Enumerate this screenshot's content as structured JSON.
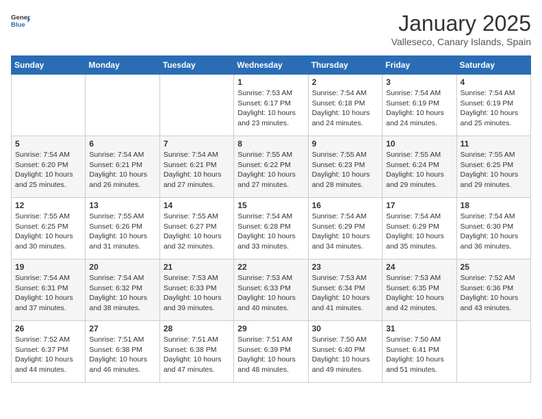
{
  "header": {
    "logo": {
      "general": "General",
      "blue": "Blue"
    },
    "title": "January 2025",
    "subtitle": "Valleseco, Canary Islands, Spain"
  },
  "days_of_week": [
    "Sunday",
    "Monday",
    "Tuesday",
    "Wednesday",
    "Thursday",
    "Friday",
    "Saturday"
  ],
  "weeks": [
    [
      {
        "day": "",
        "sunrise": "",
        "sunset": "",
        "daylight": ""
      },
      {
        "day": "",
        "sunrise": "",
        "sunset": "",
        "daylight": ""
      },
      {
        "day": "",
        "sunrise": "",
        "sunset": "",
        "daylight": ""
      },
      {
        "day": "1",
        "sunrise": "Sunrise: 7:53 AM",
        "sunset": "Sunset: 6:17 PM",
        "daylight": "Daylight: 10 hours and 23 minutes."
      },
      {
        "day": "2",
        "sunrise": "Sunrise: 7:54 AM",
        "sunset": "Sunset: 6:18 PM",
        "daylight": "Daylight: 10 hours and 24 minutes."
      },
      {
        "day": "3",
        "sunrise": "Sunrise: 7:54 AM",
        "sunset": "Sunset: 6:19 PM",
        "daylight": "Daylight: 10 hours and 24 minutes."
      },
      {
        "day": "4",
        "sunrise": "Sunrise: 7:54 AM",
        "sunset": "Sunset: 6:19 PM",
        "daylight": "Daylight: 10 hours and 25 minutes."
      }
    ],
    [
      {
        "day": "5",
        "sunrise": "Sunrise: 7:54 AM",
        "sunset": "Sunset: 6:20 PM",
        "daylight": "Daylight: 10 hours and 25 minutes."
      },
      {
        "day": "6",
        "sunrise": "Sunrise: 7:54 AM",
        "sunset": "Sunset: 6:21 PM",
        "daylight": "Daylight: 10 hours and 26 minutes."
      },
      {
        "day": "7",
        "sunrise": "Sunrise: 7:54 AM",
        "sunset": "Sunset: 6:21 PM",
        "daylight": "Daylight: 10 hours and 27 minutes."
      },
      {
        "day": "8",
        "sunrise": "Sunrise: 7:55 AM",
        "sunset": "Sunset: 6:22 PM",
        "daylight": "Daylight: 10 hours and 27 minutes."
      },
      {
        "day": "9",
        "sunrise": "Sunrise: 7:55 AM",
        "sunset": "Sunset: 6:23 PM",
        "daylight": "Daylight: 10 hours and 28 minutes."
      },
      {
        "day": "10",
        "sunrise": "Sunrise: 7:55 AM",
        "sunset": "Sunset: 6:24 PM",
        "daylight": "Daylight: 10 hours and 29 minutes."
      },
      {
        "day": "11",
        "sunrise": "Sunrise: 7:55 AM",
        "sunset": "Sunset: 6:25 PM",
        "daylight": "Daylight: 10 hours and 29 minutes."
      }
    ],
    [
      {
        "day": "12",
        "sunrise": "Sunrise: 7:55 AM",
        "sunset": "Sunset: 6:25 PM",
        "daylight": "Daylight: 10 hours and 30 minutes."
      },
      {
        "day": "13",
        "sunrise": "Sunrise: 7:55 AM",
        "sunset": "Sunset: 6:26 PM",
        "daylight": "Daylight: 10 hours and 31 minutes."
      },
      {
        "day": "14",
        "sunrise": "Sunrise: 7:55 AM",
        "sunset": "Sunset: 6:27 PM",
        "daylight": "Daylight: 10 hours and 32 minutes."
      },
      {
        "day": "15",
        "sunrise": "Sunrise: 7:54 AM",
        "sunset": "Sunset: 6:28 PM",
        "daylight": "Daylight: 10 hours and 33 minutes."
      },
      {
        "day": "16",
        "sunrise": "Sunrise: 7:54 AM",
        "sunset": "Sunset: 6:29 PM",
        "daylight": "Daylight: 10 hours and 34 minutes."
      },
      {
        "day": "17",
        "sunrise": "Sunrise: 7:54 AM",
        "sunset": "Sunset: 6:29 PM",
        "daylight": "Daylight: 10 hours and 35 minutes."
      },
      {
        "day": "18",
        "sunrise": "Sunrise: 7:54 AM",
        "sunset": "Sunset: 6:30 PM",
        "daylight": "Daylight: 10 hours and 36 minutes."
      }
    ],
    [
      {
        "day": "19",
        "sunrise": "Sunrise: 7:54 AM",
        "sunset": "Sunset: 6:31 PM",
        "daylight": "Daylight: 10 hours and 37 minutes."
      },
      {
        "day": "20",
        "sunrise": "Sunrise: 7:54 AM",
        "sunset": "Sunset: 6:32 PM",
        "daylight": "Daylight: 10 hours and 38 minutes."
      },
      {
        "day": "21",
        "sunrise": "Sunrise: 7:53 AM",
        "sunset": "Sunset: 6:33 PM",
        "daylight": "Daylight: 10 hours and 39 minutes."
      },
      {
        "day": "22",
        "sunrise": "Sunrise: 7:53 AM",
        "sunset": "Sunset: 6:33 PM",
        "daylight": "Daylight: 10 hours and 40 minutes."
      },
      {
        "day": "23",
        "sunrise": "Sunrise: 7:53 AM",
        "sunset": "Sunset: 6:34 PM",
        "daylight": "Daylight: 10 hours and 41 minutes."
      },
      {
        "day": "24",
        "sunrise": "Sunrise: 7:53 AM",
        "sunset": "Sunset: 6:35 PM",
        "daylight": "Daylight: 10 hours and 42 minutes."
      },
      {
        "day": "25",
        "sunrise": "Sunrise: 7:52 AM",
        "sunset": "Sunset: 6:36 PM",
        "daylight": "Daylight: 10 hours and 43 minutes."
      }
    ],
    [
      {
        "day": "26",
        "sunrise": "Sunrise: 7:52 AM",
        "sunset": "Sunset: 6:37 PM",
        "daylight": "Daylight: 10 hours and 44 minutes."
      },
      {
        "day": "27",
        "sunrise": "Sunrise: 7:51 AM",
        "sunset": "Sunset: 6:38 PM",
        "daylight": "Daylight: 10 hours and 46 minutes."
      },
      {
        "day": "28",
        "sunrise": "Sunrise: 7:51 AM",
        "sunset": "Sunset: 6:38 PM",
        "daylight": "Daylight: 10 hours and 47 minutes."
      },
      {
        "day": "29",
        "sunrise": "Sunrise: 7:51 AM",
        "sunset": "Sunset: 6:39 PM",
        "daylight": "Daylight: 10 hours and 48 minutes."
      },
      {
        "day": "30",
        "sunrise": "Sunrise: 7:50 AM",
        "sunset": "Sunset: 6:40 PM",
        "daylight": "Daylight: 10 hours and 49 minutes."
      },
      {
        "day": "31",
        "sunrise": "Sunrise: 7:50 AM",
        "sunset": "Sunset: 6:41 PM",
        "daylight": "Daylight: 10 hours and 51 minutes."
      },
      {
        "day": "",
        "sunrise": "",
        "sunset": "",
        "daylight": ""
      }
    ]
  ]
}
